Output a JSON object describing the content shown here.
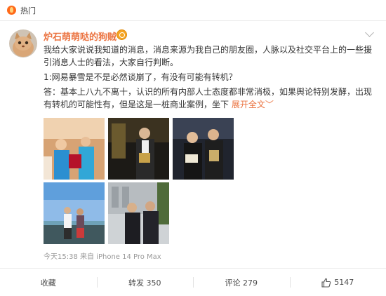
{
  "header": {
    "hot_label": "热门"
  },
  "post": {
    "author": "炉石萌萌哒的狗贼丶",
    "paragraph1": "我给大家说说我知道的消息，消息来源为我自己的朋友圈，人脉以及社交平台上的一些援引消息人士的看法，大家自行判断。",
    "paragraph2": "1:网易暴雪是不是必然谈崩了，有没有可能有转机？",
    "paragraph3": "答：基本上八九不离十，认识的所有内部人士态度都非常消极，如果舆论特别发酵，出现有转机的可能性有，但是这是一桩商业案例，坐下",
    "expand_label": "展开全文",
    "expand_arrow": "﹀",
    "meta": "今天15:38 来自 iPhone 14 Pro Max"
  },
  "actions": {
    "favorite": "收藏",
    "repost": "转发 350",
    "comment": "评论 279",
    "like": "5147"
  },
  "colors": {
    "accent": "#eb7340",
    "hot": "#ff6a1a"
  }
}
